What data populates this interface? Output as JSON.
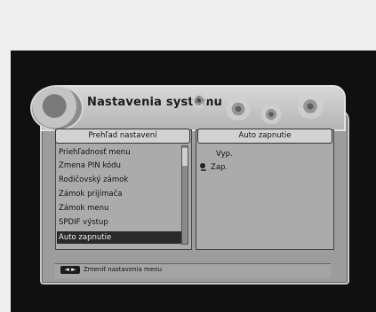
{
  "window": {
    "title": "Nastavenia systému"
  },
  "left_panel": {
    "header": "Prehľad nastavení",
    "items": [
      {
        "label": "Priehľadnosť menu"
      },
      {
        "label": "Zmena PIN kódu"
      },
      {
        "label": "Rodičovský zámok"
      },
      {
        "label": "Zámok prijímača"
      },
      {
        "label": "Zámok menu"
      },
      {
        "label": "SPDIF výstup"
      },
      {
        "label": "Auto zapnutie",
        "selected": true
      }
    ]
  },
  "right_panel": {
    "header": "Auto zapnutie",
    "options": [
      {
        "label": "Vyp.",
        "selected": false
      },
      {
        "label": "Zap.",
        "selected": true
      }
    ]
  },
  "status_bar": {
    "key_label": "◄ ►",
    "hint": "Zmeniť nastavenia menu"
  },
  "colors": {
    "screen_bg": "#101010",
    "window_bg": "#9c9c9c",
    "selected_bg": "#2a2a2a"
  }
}
